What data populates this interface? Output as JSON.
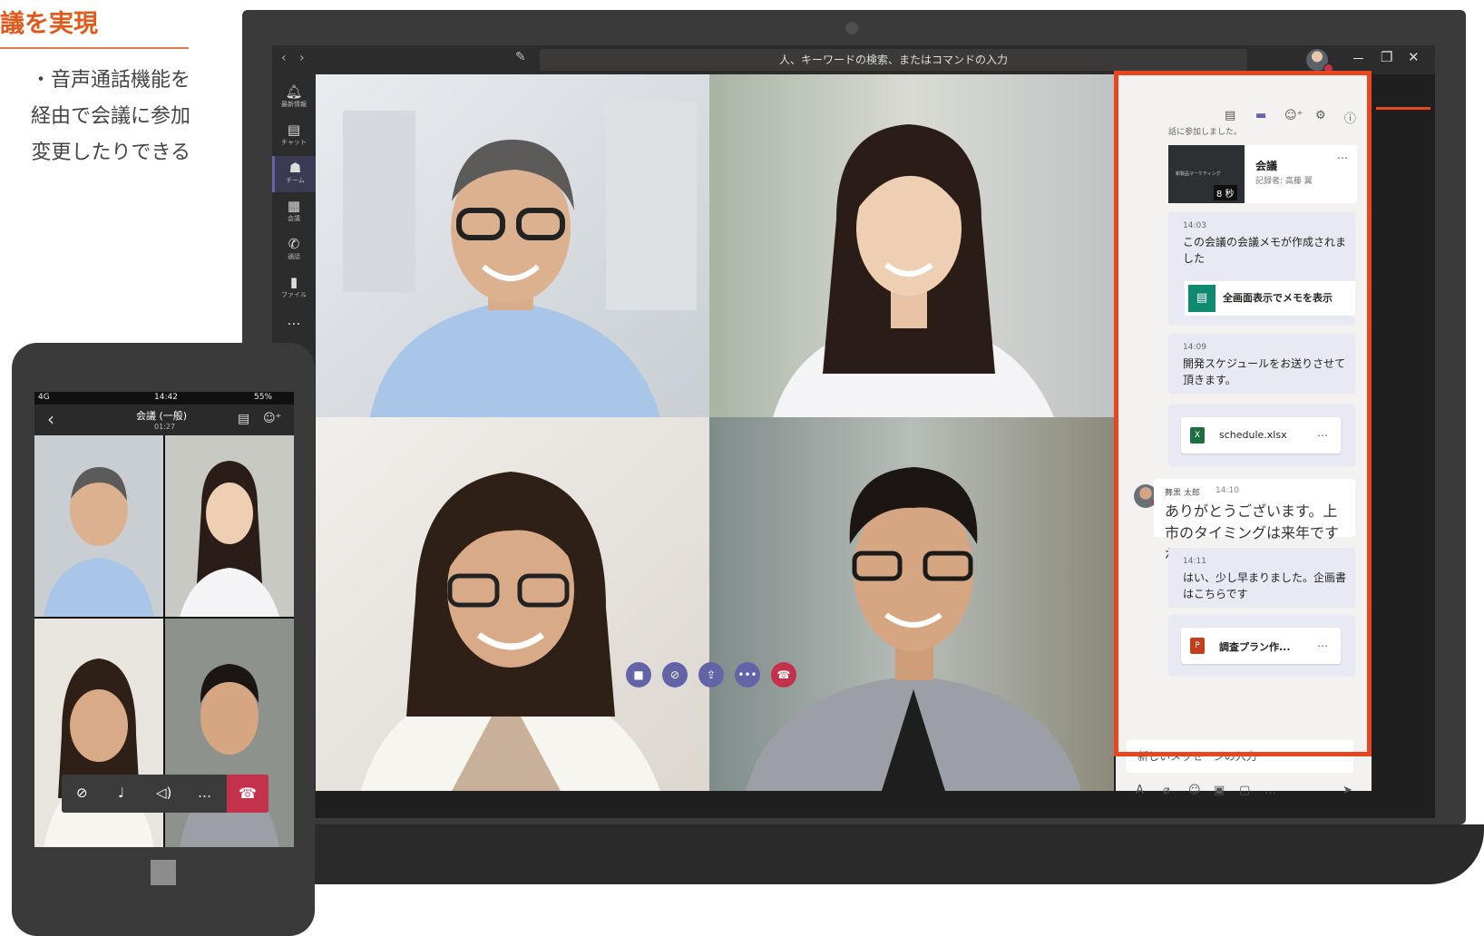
{
  "page": {
    "heading": "議を実現",
    "lines": [
      "・音声通話機能を",
      "経由で会議に参加",
      "変更したりできる"
    ]
  },
  "titlebar": {
    "back_icon": "chevron-left-icon",
    "forward_icon": "chevron-right-icon",
    "search_placeholder": "人、キーワードの検索、またはコマンドの入力",
    "min": "－",
    "max": "❐",
    "close": "✕"
  },
  "rail": {
    "items": [
      {
        "label": "最新情報",
        "icon": "bell-icon"
      },
      {
        "label": "チャット",
        "icon": "chat-icon"
      },
      {
        "label": "チーム",
        "icon": "teams-icon"
      },
      {
        "label": "会議",
        "icon": "calendar-icon"
      },
      {
        "label": "通話",
        "icon": "phone-icon"
      },
      {
        "label": "ファイル",
        "icon": "file-icon"
      },
      {
        "label": "…",
        "icon": "more-icon"
      }
    ]
  },
  "controls": [
    "video-icon",
    "mic-off-icon",
    "share-screen-icon",
    "more-icon",
    "hangup-icon"
  ],
  "chat": {
    "joined_text": "話に参加しました。",
    "recording": {
      "title": "会議",
      "subtitle": "記録者: 高藤 翼",
      "duration": "8 秒",
      "more": "…",
      "thumb_text": "新製品マーケティング"
    },
    "messages": [
      {
        "time": "14:03",
        "text": "この会議の会議メモが作成されました"
      },
      {
        "time": "14:09",
        "text": "開発スケジュールをお送りさせて頂きます。"
      },
      {
        "time": "14:11",
        "text": "はい、少し早まりました。企画書はこちらです"
      }
    ],
    "notes_button": "全画面表示でメモを表示",
    "file1": {
      "name": "schedule.xlsx",
      "more": "…",
      "badge": "X"
    },
    "file2": {
      "name": "調査プラン作...",
      "more": "…",
      "badge": "P"
    },
    "reply": {
      "sender": "舞黒 太郎",
      "time": "14:10",
      "text": "ありがとうございます。上市のタイミングは来年ですね。"
    },
    "composer_placeholder": "新しいメッセージの入力",
    "format_more": "…"
  },
  "phone": {
    "signal": "4G",
    "clock": "14:42",
    "battery": "55%",
    "title": "会議 (一般)",
    "elapsed": "01:27",
    "more": "…"
  },
  "colors": {
    "accent_orange": "#e8461e",
    "teams_purple": "#6264a7",
    "hangup_red": "#c4314b"
  }
}
